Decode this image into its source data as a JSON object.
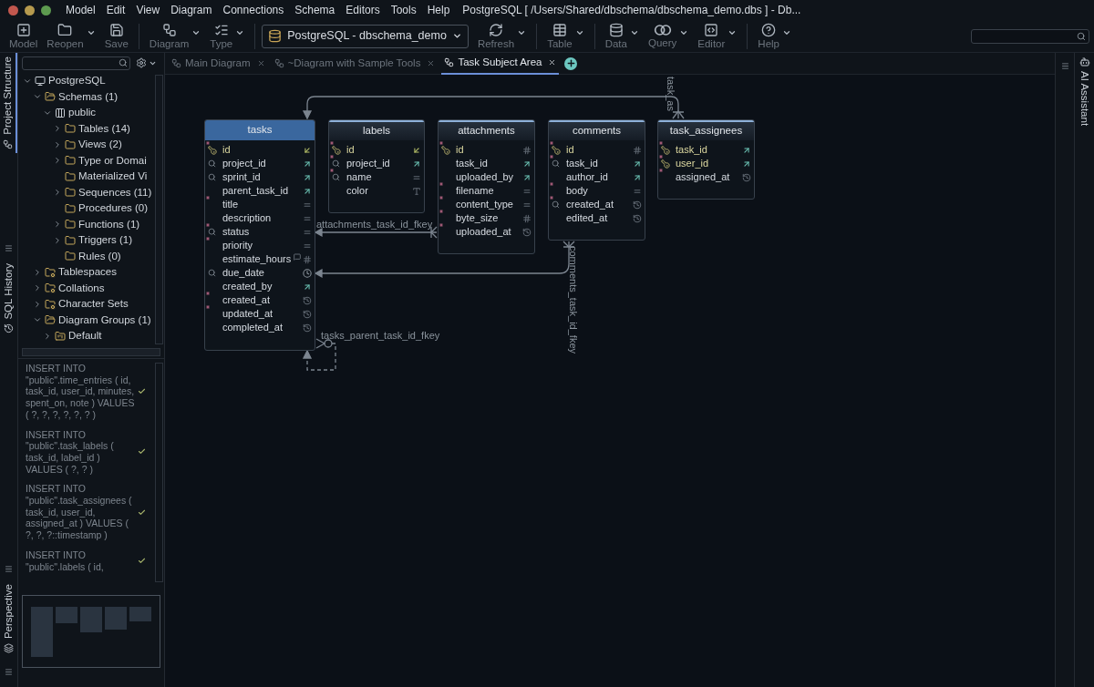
{
  "window": {
    "title": "PostgreSQL [ /Users/Shared/dbschema/dbschema_demo.dbs ] - Db..."
  },
  "menu": [
    "Model",
    "Edit",
    "View",
    "Diagram",
    "Connections",
    "Schema",
    "Editors",
    "Tools",
    "Help"
  ],
  "toolbar": {
    "groups": [
      [
        {
          "kind": "button",
          "label": "Model",
          "dropdown": false
        },
        {
          "kind": "button",
          "label": "Reopen",
          "dropdown": true
        },
        {
          "kind": "button",
          "label": "Save",
          "dropdown": false
        }
      ],
      [
        {
          "kind": "button",
          "label": "Diagram",
          "dropdown": true
        },
        {
          "kind": "button",
          "label": "Type",
          "dropdown": true
        }
      ],
      [
        {
          "kind": "select",
          "label": "PostgreSQL - dbschema_demo",
          "dropdown": true
        },
        {
          "kind": "button",
          "label": "Refresh",
          "dropdown": true
        }
      ],
      [
        {
          "kind": "button",
          "label": "Table",
          "dropdown": true
        }
      ],
      [
        {
          "kind": "button",
          "label": "Data",
          "dropdown": true
        },
        {
          "kind": "button",
          "label": "Query",
          "dropdown": true
        },
        {
          "kind": "button",
          "label": "Editor",
          "dropdown": true
        }
      ],
      [
        {
          "kind": "button",
          "label": "Help",
          "dropdown": true
        }
      ]
    ]
  },
  "side_tabs": [
    {
      "label": "Project Structure",
      "selected": true
    },
    {
      "label": "SQL History",
      "selected": false
    },
    {
      "label": "Perspective",
      "selected": false
    }
  ],
  "tree": [
    {
      "label": "PostgreSQL",
      "kind": "server",
      "expanded": true,
      "children": [
        {
          "label": "Schemas (1)",
          "kind": "folder",
          "expanded": true,
          "children": [
            {
              "label": "public",
              "kind": "schema",
              "expanded": true,
              "children": [
                {
                  "label": "Tables (14)",
                  "kind": "folder",
                  "expanded": false
                },
                {
                  "label": "Views (2)",
                  "kind": "folder",
                  "expanded": false
                },
                {
                  "label": "Type or Domai",
                  "kind": "folder",
                  "expanded": false
                },
                {
                  "label": "Materialized Vi",
                  "kind": "folder"
                },
                {
                  "label": "Sequences (11)",
                  "kind": "folder",
                  "expanded": false
                },
                {
                  "label": "Procedures (0)",
                  "kind": "folder"
                },
                {
                  "label": "Functions (1)",
                  "kind": "folder",
                  "expanded": false
                },
                {
                  "label": "Triggers (1)",
                  "kind": "folder",
                  "expanded": false
                },
                {
                  "label": "Rules (0)",
                  "kind": "folder"
                }
              ]
            }
          ]
        },
        {
          "label": "Tablespaces",
          "kind": "special",
          "expanded": false
        },
        {
          "label": "Collations",
          "kind": "special",
          "expanded": false
        },
        {
          "label": "Character Sets",
          "kind": "special",
          "expanded": false
        },
        {
          "label": "Diagram Groups (1)",
          "kind": "folder",
          "expanded": true,
          "children": [
            {
              "label": "Default",
              "kind": "group",
              "expanded": false
            }
          ]
        }
      ]
    }
  ],
  "sql_history": [
    {
      "text": "INSERT INTO \"public\".time_entries ( id, task_id, user_id, minutes, spent_on, note ) VALUES ( ?, ?, ?, ?, ?, ? )",
      "ok": true
    },
    {
      "text": "INSERT INTO \"public\".task_labels ( task_id, label_id ) VALUES ( ?, ? )",
      "ok": true
    },
    {
      "text": "INSERT INTO \"public\".task_assignees ( task_id, user_id, assigned_at ) VALUES ( ?, ?, ?::timestamp )",
      "ok": true
    },
    {
      "text": "INSERT INTO \"public\".labels ( id,",
      "ok": true
    }
  ],
  "tabs": [
    {
      "label": "Main Diagram",
      "selected": false
    },
    {
      "label": "~Diagram with Sample Tools",
      "selected": false
    },
    {
      "label": "Task Subject Area",
      "selected": true
    }
  ],
  "right_panel": {
    "label": "AI Assistant"
  },
  "tables": [
    {
      "name": "tasks",
      "selected": true,
      "columns": [
        {
          "name": "id",
          "pk": true,
          "required": true,
          "kind": "ref-in"
        },
        {
          "name": "project_id",
          "pk": false,
          "required": false,
          "indexed": true,
          "kind": "fk"
        },
        {
          "name": "sprint_id",
          "pk": false,
          "required": false,
          "indexed": true,
          "kind": "fk"
        },
        {
          "name": "parent_task_id",
          "pk": false,
          "required": false,
          "indexed": false,
          "kind": "fk"
        },
        {
          "name": "title",
          "pk": false,
          "required": true,
          "indexed": false,
          "kind": "text"
        },
        {
          "name": "description",
          "pk": false,
          "required": false,
          "indexed": false,
          "kind": "text"
        },
        {
          "name": "status",
          "pk": false,
          "required": true,
          "indexed": true,
          "kind": "text"
        },
        {
          "name": "priority",
          "pk": false,
          "required": true,
          "indexed": false,
          "kind": "text"
        },
        {
          "name": "estimate_hours",
          "pk": false,
          "required": false,
          "indexed": false,
          "kind": "number",
          "comment": true
        },
        {
          "name": "due_date",
          "pk": false,
          "required": false,
          "indexed": true,
          "kind": "date"
        },
        {
          "name": "created_by",
          "pk": false,
          "required": false,
          "indexed": false,
          "kind": "fk"
        },
        {
          "name": "created_at",
          "pk": false,
          "required": true,
          "indexed": false,
          "kind": "time"
        },
        {
          "name": "updated_at",
          "pk": false,
          "required": true,
          "indexed": false,
          "kind": "time"
        },
        {
          "name": "completed_at",
          "pk": false,
          "required": false,
          "indexed": false,
          "kind": "time"
        }
      ]
    },
    {
      "name": "labels",
      "selected": false,
      "columns": [
        {
          "name": "id",
          "pk": true,
          "required": true,
          "kind": "ref-in"
        },
        {
          "name": "project_id",
          "pk": false,
          "required": true,
          "indexed": true,
          "kind": "fk"
        },
        {
          "name": "name",
          "pk": false,
          "required": true,
          "indexed": true,
          "kind": "text"
        },
        {
          "name": "color",
          "pk": false,
          "required": false,
          "indexed": false,
          "kind": "color"
        }
      ]
    },
    {
      "name": "attachments",
      "selected": false,
      "columns": [
        {
          "name": "id",
          "pk": true,
          "required": true,
          "kind": "number"
        },
        {
          "name": "task_id",
          "pk": false,
          "required": false,
          "indexed": false,
          "kind": "fk"
        },
        {
          "name": "uploaded_by",
          "pk": false,
          "required": false,
          "indexed": false,
          "kind": "fk"
        },
        {
          "name": "filename",
          "pk": false,
          "required": true,
          "indexed": false,
          "kind": "text"
        },
        {
          "name": "content_type",
          "pk": false,
          "required": true,
          "indexed": false,
          "kind": "text"
        },
        {
          "name": "byte_size",
          "pk": false,
          "required": true,
          "indexed": false,
          "kind": "number"
        },
        {
          "name": "uploaded_at",
          "pk": false,
          "required": true,
          "indexed": false,
          "kind": "time"
        }
      ]
    },
    {
      "name": "comments",
      "selected": false,
      "columns": [
        {
          "name": "id",
          "pk": true,
          "required": true,
          "kind": "number"
        },
        {
          "name": "task_id",
          "pk": false,
          "required": true,
          "indexed": true,
          "kind": "fk"
        },
        {
          "name": "author_id",
          "pk": false,
          "required": false,
          "indexed": false,
          "kind": "fk"
        },
        {
          "name": "body",
          "pk": false,
          "required": true,
          "indexed": false,
          "kind": "text"
        },
        {
          "name": "created_at",
          "pk": false,
          "required": true,
          "indexed": true,
          "kind": "time"
        },
        {
          "name": "edited_at",
          "pk": false,
          "required": false,
          "indexed": false,
          "kind": "time"
        }
      ]
    },
    {
      "name": "task_assignees",
      "selected": false,
      "columns": [
        {
          "name": "task_id",
          "pk": true,
          "required": true,
          "kind": "fk"
        },
        {
          "name": "user_id",
          "pk": true,
          "required": true,
          "kind": "fk"
        },
        {
          "name": "assigned_at",
          "pk": false,
          "required": true,
          "indexed": false,
          "kind": "time"
        }
      ]
    }
  ],
  "relationships": [
    {
      "name": "task_as"
    },
    {
      "name": "attachments_task_id_fkey"
    },
    {
      "name": "comments_task_id_fkey"
    },
    {
      "name": "tasks_parent_task_id_fkey"
    }
  ]
}
